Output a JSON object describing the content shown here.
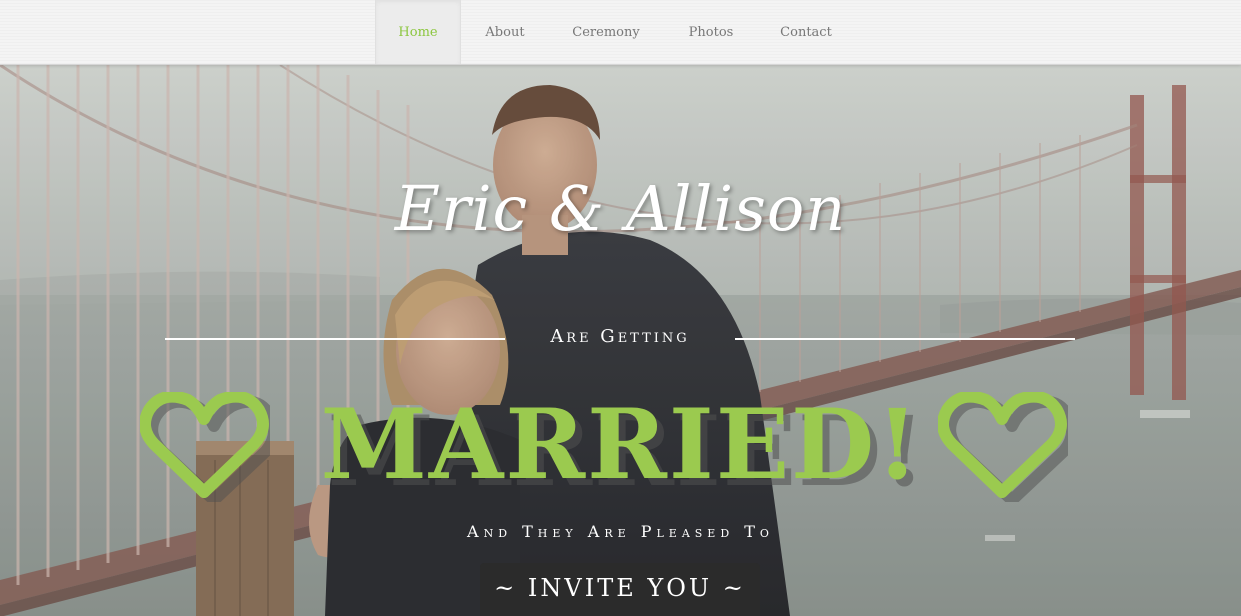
{
  "nav": {
    "items": [
      {
        "label": "Home",
        "active": true
      },
      {
        "label": "About",
        "active": false
      },
      {
        "label": "Ceremony",
        "active": false
      },
      {
        "label": "Photos",
        "active": false
      },
      {
        "label": "Contact",
        "active": false
      }
    ]
  },
  "hero": {
    "names": "Eric & Allison",
    "getting": "Are Getting",
    "married": "MARRIED!",
    "pleased": "And They Are Pleased To",
    "invite": "~ INVITE YOU ~"
  },
  "colors": {
    "accent": "#9bca4f",
    "nav_active": "#8cc63f",
    "nav_text": "#777777",
    "invite_bg": "#2b2b2b"
  },
  "icons": {
    "left_heart": "heart-outline-icon",
    "right_heart": "heart-outline-icon"
  }
}
